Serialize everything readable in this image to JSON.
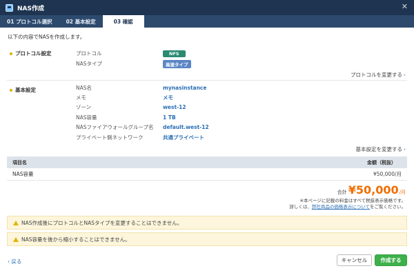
{
  "window": {
    "title": "NAS作成",
    "close_glyph": "✕"
  },
  "tabs": [
    {
      "label": "01 プロトコル選択"
    },
    {
      "label": "02 基本設定"
    },
    {
      "label": "03 確認"
    }
  ],
  "intro": "以下の内容でNASを作成します。",
  "protocol_section": {
    "label": "プロトコル設定",
    "rows": [
      {
        "key": "プロトコル",
        "value": "NFS"
      },
      {
        "key": "NASタイプ",
        "value": "高速タイプ"
      }
    ],
    "change_link": "プロトコルを変更する"
  },
  "basic_section": {
    "label": "基本設定",
    "rows": [
      {
        "key": "NAS名",
        "value": "mynasinstance"
      },
      {
        "key": "メモ",
        "value": "メモ"
      },
      {
        "key": "ゾーン",
        "value": "west-12"
      },
      {
        "key": "NAS容量",
        "value": "1 TB"
      },
      {
        "key": "NASファイアウォールグループ名",
        "value": "default.west-12"
      },
      {
        "key": "プライベート側ネットワーク",
        "value": "共通プライベート"
      }
    ],
    "change_link": "基本設定を変更する"
  },
  "pricing": {
    "headers": {
      "item": "項目名",
      "amount": "金額（税抜）"
    },
    "rows": [
      {
        "item": "NAS容量",
        "amount": "¥50,000/月"
      }
    ],
    "total_label": "合計",
    "total_amount": "¥50,000",
    "total_unit": "/月",
    "note_line1": "※本ページに記載の料金はすべて税抜表示価格です。",
    "note_prefix": "詳しくは、",
    "note_link": "弊社商品の価格表示について",
    "note_suffix": "をご覧ください。"
  },
  "warnings": [
    "NAS作成後にプロトコルとNASタイプを変更することはできません。",
    "NAS容量を後から縮小することはできません。"
  ],
  "footer": {
    "back": "戻る",
    "cancel": "キャンセル",
    "create": "作成する"
  },
  "colors": {
    "accent_orange": "#ef6e00",
    "create_green": "#3eb04b",
    "titlebar": "#1e3450"
  }
}
